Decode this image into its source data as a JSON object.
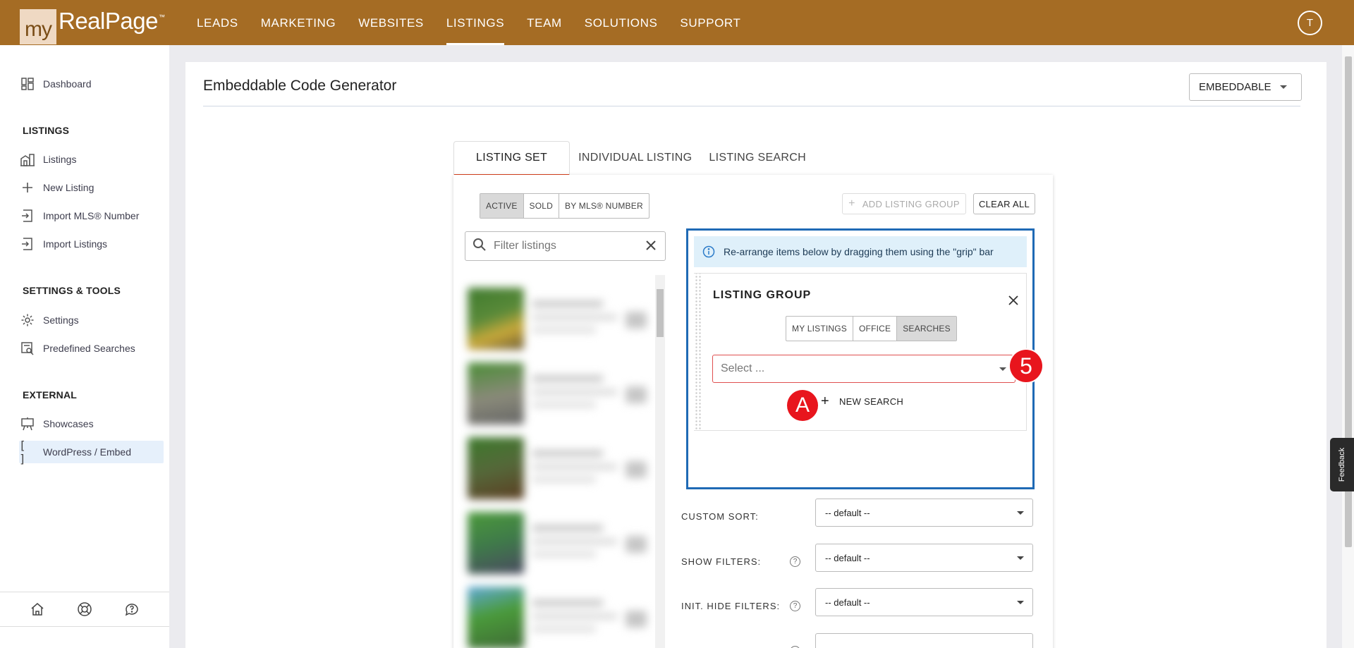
{
  "header": {
    "logo_prefix": "my",
    "logo_main": "RealPage",
    "logo_mark": "™",
    "nav": [
      "LEADS",
      "MARKETING",
      "WEBSITES",
      "LISTINGS",
      "TEAM",
      "SOLUTIONS",
      "SUPPORT"
    ],
    "active_nav": "LISTINGS",
    "avatar_initial": "T",
    "brand_color": "#a56c24"
  },
  "sidebar": {
    "dashboard": "Dashboard",
    "section_listings": "LISTINGS",
    "listings": [
      "Listings",
      "New Listing",
      "Import MLS® Number",
      "Import Listings"
    ],
    "section_settings": "SETTINGS & TOOLS",
    "settings": [
      "Settings",
      "Predefined Searches"
    ],
    "section_external": "EXTERNAL",
    "external": [
      "Showcases",
      "WordPress / Embed"
    ],
    "active_item": "WordPress / Embed"
  },
  "main": {
    "title": "Embeddable Code Generator",
    "mode_select": "EMBEDDABLE",
    "tabs": [
      "LISTING SET",
      "INDIVIDUAL LISTING",
      "LISTING SEARCH"
    ],
    "active_tab": "LISTING SET",
    "status_segments": [
      "ACTIVE",
      "SOLD",
      "BY MLS® NUMBER"
    ],
    "active_status": "ACTIVE",
    "filter_placeholder": "Filter listings",
    "add_group_label": "ADD LISTING GROUP",
    "clear_all_label": "CLEAR ALL",
    "info_text": "Re-arrange items below by dragging them using the \"grip\" bar",
    "group": {
      "title": "LISTING GROUP",
      "sources": [
        "MY LISTINGS",
        "OFFICE",
        "SEARCHES"
      ],
      "active_source": "SEARCHES",
      "select_placeholder": "Select ...",
      "new_search_label": "NEW SEARCH"
    },
    "options": [
      {
        "label": "CUSTOM SORT:",
        "value": "-- default --",
        "help": false
      },
      {
        "label": "SHOW FILTERS:",
        "value": "-- default --",
        "help": true
      },
      {
        "label": "INIT. HIDE FILTERS:",
        "value": "-- default --",
        "help": true
      }
    ]
  },
  "markers": {
    "step": "5",
    "letter": "A"
  },
  "feedback_label": "Feedback",
  "footer_icons": [
    "home-icon",
    "lifebuoy-icon",
    "chat-help-icon"
  ]
}
